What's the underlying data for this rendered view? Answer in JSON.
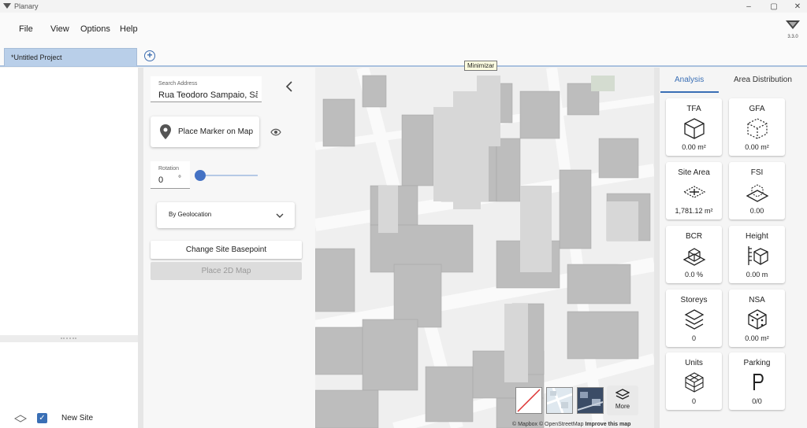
{
  "window": {
    "title": "Planary",
    "controls": [
      "–",
      "▢",
      "✕"
    ]
  },
  "menu": {
    "items": [
      "File",
      "View",
      "Options",
      "Help"
    ]
  },
  "logo": {
    "version": "3.3.0"
  },
  "tabs": {
    "items": [
      "*Untitled Project"
    ],
    "add_icon": "plus-circle-icon"
  },
  "tooltip": {
    "text": "Minimizar"
  },
  "sites": {
    "items": [
      {
        "label": "New Site",
        "checked": true,
        "icon": "site-diamond-icon"
      }
    ]
  },
  "form": {
    "address": {
      "label": "Search Address",
      "value": "Rua Teodoro Sampaio, São"
    },
    "place_marker_label": "Place Marker on Map",
    "rotation": {
      "label": "Rotation",
      "value": "0",
      "unit": "°",
      "slider_fraction": 0
    },
    "geolocation_select": "By Geolocation",
    "change_basepoint_label": "Change Site Basepoint",
    "place_2d_map_label": "Place 2D Map"
  },
  "map": {
    "attribution": "© Mapbox © OpenStreetMap",
    "improve_link": "Improve this map",
    "more_label": "More"
  },
  "analysis": {
    "tabs": [
      "Analysis",
      "Area Distribution"
    ],
    "active_tab": 0,
    "metrics": [
      {
        "title": "TFA",
        "value": "0.00 m²",
        "icon": "cube-icon"
      },
      {
        "title": "GFA",
        "value": "0.00 m²",
        "icon": "cube-dashed-icon"
      },
      {
        "title": "Site Area",
        "value": "1,781.12 m²",
        "icon": "site-area-icon"
      },
      {
        "title": "FSI",
        "value": "0.00",
        "icon": "fsi-icon"
      },
      {
        "title": "BCR",
        "value": "0.0 %",
        "icon": "bcr-icon"
      },
      {
        "title": "Height",
        "value": "0.00 m",
        "icon": "height-icon"
      },
      {
        "title": "Storeys",
        "value": "0",
        "icon": "layers-icon"
      },
      {
        "title": "NSA",
        "value": "0.00 m²",
        "icon": "nsa-icon"
      },
      {
        "title": "Units",
        "value": "0",
        "icon": "units-icon"
      },
      {
        "title": "Parking",
        "value": "0/0",
        "icon": "parking-icon"
      }
    ]
  }
}
